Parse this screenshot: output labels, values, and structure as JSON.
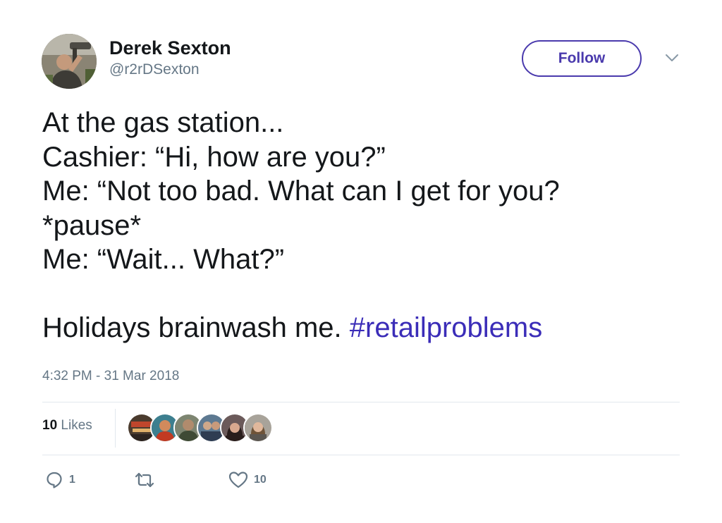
{
  "user": {
    "display_name": "Derek Sexton",
    "screen_name": "@r2rDSexton",
    "avatar_icon": "profile-photo"
  },
  "follow_button": {
    "label": "Follow",
    "color": "#4a3aad"
  },
  "menu_icon": "chevron-down-icon",
  "tweet": {
    "lines": [
      "At the gas station...",
      "Cashier: “Hi, how are you?”",
      "Me: “Not too bad. What can I get for you?",
      "*pause*",
      "Me: “Wait... What?”",
      ""
    ],
    "last_line_text": "Holidays brainwash me.",
    "hashtag": "#retailproblems",
    "hashtag_color": "#3b2db8",
    "timestamp": "4:32 PM - 31 Mar 2018"
  },
  "engagement": {
    "likes_number": "10",
    "likes_label": "Likes",
    "likers_count": 6
  },
  "actions": {
    "reply": {
      "icon": "reply-icon",
      "count": "1"
    },
    "retweet": {
      "icon": "retweet-icon",
      "count": ""
    },
    "like": {
      "icon": "heart-icon",
      "count": "10"
    }
  },
  "colors": {
    "text": "#14171a",
    "secondary": "#657786",
    "divider": "#e1e8ed"
  }
}
